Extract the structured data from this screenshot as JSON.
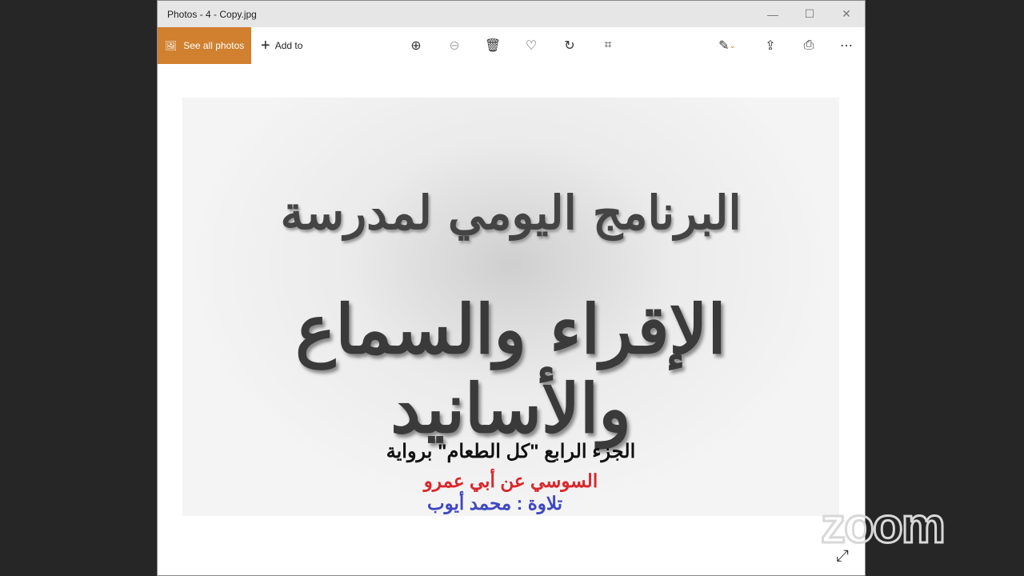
{
  "window": {
    "title": "Photos - 4 - Copy.jpg",
    "minimize": "—",
    "maximize": "☐",
    "close": "✕"
  },
  "toolbar": {
    "see_all": "See all photos",
    "add_to": "Add to"
  },
  "image": {
    "calligraphy_line1": "البرنامج اليومي لمدرسة",
    "calligraphy_line2": "الإقراء والسماع والأسانيد",
    "line1": "الجزء الرابع \"كل الطعام\" برواية",
    "line2": "السوسي عن أبي عمرو",
    "line3": "تلاوة : محمد أيوب"
  },
  "watermark": "zoom"
}
